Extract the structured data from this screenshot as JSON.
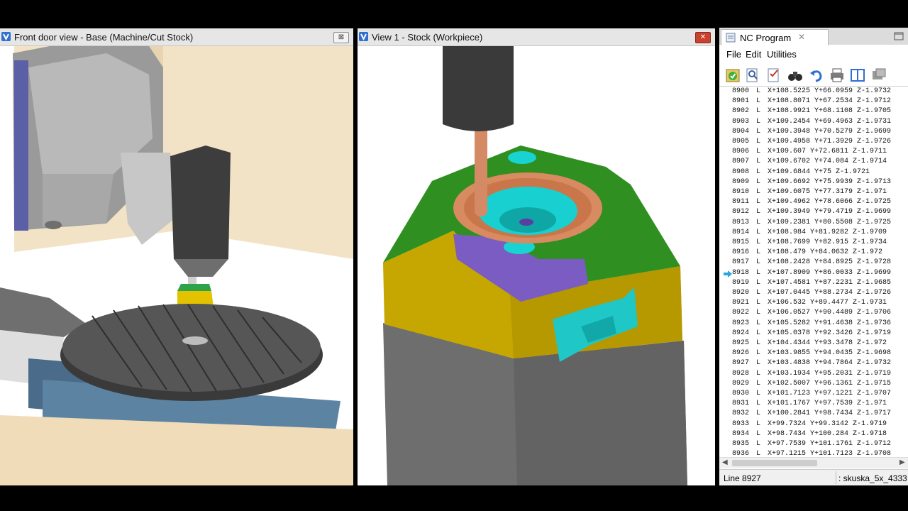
{
  "left_view": {
    "title": "Front door view - Base (Machine/Cut Stock)",
    "close": "⊠"
  },
  "right_view": {
    "title": "View 1 - Stock (Workpiece)",
    "close": "✕"
  },
  "nc_program": {
    "tab_label": "NC Program",
    "tab_close": "✕",
    "menu": {
      "file": "File",
      "edit": "Edit",
      "utilities": "Utilities"
    },
    "toolbar_icons": [
      "check-icon",
      "search-nc-icon",
      "edit-nc-icon",
      "binoculars-icon",
      "undo-icon",
      "print-icon",
      "columns-icon",
      "window-icon"
    ],
    "current_line_index": 18,
    "rows": [
      {
        "n": "8900",
        "c": "L",
        "v": "X+108.5225 Y+66.0959 Z-1.9732"
      },
      {
        "n": "8901",
        "c": "L",
        "v": "X+108.8071 Y+67.2534 Z-1.9712"
      },
      {
        "n": "8902",
        "c": "L",
        "v": "X+108.9921 Y+68.1108 Z-1.9705"
      },
      {
        "n": "8903",
        "c": "L",
        "v": "X+109.2454 Y+69.4963 Z-1.9731"
      },
      {
        "n": "8904",
        "c": "L",
        "v": "X+109.3948 Y+70.5279 Z-1.9699"
      },
      {
        "n": "8905",
        "c": "L",
        "v": "X+109.4958 Y+71.3929 Z-1.9726"
      },
      {
        "n": "8906",
        "c": "L",
        "v": "X+109.607 Y+72.6811 Z-1.9711"
      },
      {
        "n": "8907",
        "c": "L",
        "v": "X+109.6702 Y+74.084 Z-1.9714"
      },
      {
        "n": "8908",
        "c": "L",
        "v": "X+109.6844 Y+75 Z-1.9721"
      },
      {
        "n": "8909",
        "c": "L",
        "v": "X+109.6692 Y+75.9939 Z-1.9713"
      },
      {
        "n": "8910",
        "c": "L",
        "v": "X+109.6075 Y+77.3179 Z-1.971"
      },
      {
        "n": "8911",
        "c": "L",
        "v": "X+109.4962 Y+78.6066 Z-1.9725"
      },
      {
        "n": "8912",
        "c": "L",
        "v": "X+109.3949 Y+79.4719 Z-1.9699"
      },
      {
        "n": "8913",
        "c": "L",
        "v": "X+109.2381 Y+80.5508 Z-1.9725"
      },
      {
        "n": "8914",
        "c": "L",
        "v": "X+108.984 Y+81.9282 Z-1.9709"
      },
      {
        "n": "8915",
        "c": "L",
        "v": "X+108.7699 Y+82.915 Z-1.9734"
      },
      {
        "n": "8916",
        "c": "L",
        "v": "X+108.479 Y+84.0632 Z-1.972"
      },
      {
        "n": "8917",
        "c": "L",
        "v": "X+108.2428 Y+84.8925 Z-1.9728"
      },
      {
        "n": "8918",
        "c": "L",
        "v": "X+107.8909 Y+86.0033 Z-1.9699"
      },
      {
        "n": "8919",
        "c": "L",
        "v": "X+107.4581 Y+87.2231 Z-1.9685"
      },
      {
        "n": "8920",
        "c": "L",
        "v": "X+107.0445 Y+88.2734 Z-1.9726"
      },
      {
        "n": "8921",
        "c": "L",
        "v": "X+106.532 Y+89.4477 Z-1.9731"
      },
      {
        "n": "8922",
        "c": "L",
        "v": "X+106.0527 Y+90.4489 Z-1.9706"
      },
      {
        "n": "8923",
        "c": "L",
        "v": "X+105.5282 Y+91.4638 Z-1.9736"
      },
      {
        "n": "8924",
        "c": "L",
        "v": "X+105.0378 Y+92.3426 Z-1.9719"
      },
      {
        "n": "8925",
        "c": "L",
        "v": "X+104.4344 Y+93.3478 Z-1.972"
      },
      {
        "n": "8926",
        "c": "L",
        "v": "X+103.9855 Y+94.0435 Z-1.9698"
      },
      {
        "n": "8927",
        "c": "L",
        "v": "X+103.4838 Y+94.7864 Z-1.9732"
      },
      {
        "n": "8928",
        "c": "L",
        "v": "X+103.1934 Y+95.2031 Z-1.9719"
      },
      {
        "n": "8929",
        "c": "L",
        "v": "X+102.5007 Y+96.1361 Z-1.9715"
      },
      {
        "n": "8930",
        "c": "L",
        "v": "X+101.7123 Y+97.1221 Z-1.9707"
      },
      {
        "n": "8931",
        "c": "L",
        "v": "X+101.1767 Y+97.7539 Z-1.971"
      },
      {
        "n": "8932",
        "c": "L",
        "v": "X+100.2841 Y+98.7434 Z-1.9717"
      },
      {
        "n": "8933",
        "c": "L",
        "v": "X+99.7324 Y+99.3142 Z-1.9719"
      },
      {
        "n": "8934",
        "c": "L",
        "v": "X+98.7434 Y+100.284 Z-1.9718"
      },
      {
        "n": "8935",
        "c": "L",
        "v": "X+97.7539 Y+101.1761 Z-1.9712"
      },
      {
        "n": "8936",
        "c": "L",
        "v": "X+97.1215 Y+101.7123 Z-1.9708"
      }
    ],
    "status": {
      "line": "Line 8927",
      "file": ": skuska_5x_4333"
    },
    "colors": {
      "cursor_arrow": "#2aa7e0"
    }
  }
}
